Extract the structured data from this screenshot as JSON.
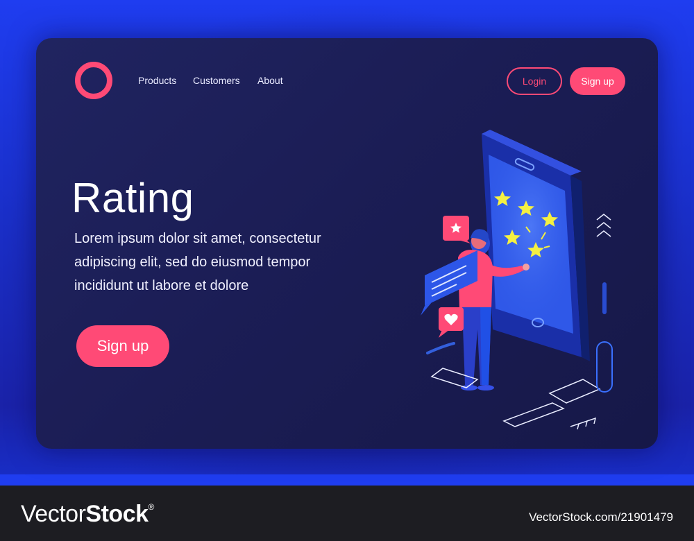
{
  "nav": {
    "items": [
      {
        "label": "Products"
      },
      {
        "label": "Customers"
      },
      {
        "label": "About"
      }
    ],
    "login_label": "Login",
    "signup_label": "Sign up"
  },
  "hero": {
    "title": "Rating",
    "body": "Lorem ipsum dolor sit amet, consectetur adipiscing elit, sed do eiusmod tempor incididunt ut labore et dolore",
    "cta_label": "Sign up"
  },
  "footer": {
    "brand_light": "Vector",
    "brand_bold": "Stock",
    "brand_mark": "®",
    "stock_id": "VectorStock.com/21901479"
  },
  "colors": {
    "accent": "#ff4a76",
    "card_bg": "#1b1d55",
    "frame_blue": "#1f3df0",
    "star": "#f4f042"
  },
  "icons": [
    "ring-logo-icon",
    "star-bubble-icon",
    "message-bubble-icon",
    "heart-bubble-icon",
    "star-icon",
    "chevron-up-icon",
    "chevron-right-icon"
  ]
}
